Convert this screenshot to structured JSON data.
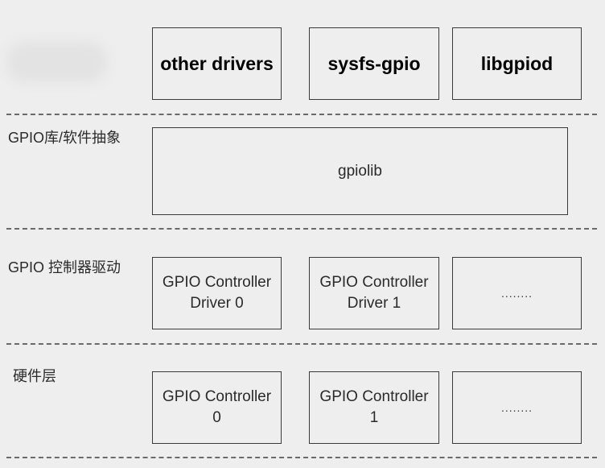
{
  "top_layer": {
    "boxes": [
      {
        "label": "other drivers"
      },
      {
        "label": "sysfs-gpio"
      },
      {
        "label": "libgpiod"
      }
    ]
  },
  "lib_layer": {
    "label": "GPIO库/软件抽象",
    "box": {
      "label": "gpiolib"
    }
  },
  "driver_layer": {
    "label": "GPIO 控制器驱动",
    "boxes": [
      {
        "label": "GPIO Controller\nDriver 0"
      },
      {
        "label": "GPIO Controller\nDriver 1"
      },
      {
        "label": "........"
      }
    ]
  },
  "hardware_layer": {
    "label": "硬件层",
    "boxes": [
      {
        "label": "GPIO Controller\n0"
      },
      {
        "label": "GPIO Controller\n1"
      },
      {
        "label": "........"
      }
    ]
  }
}
